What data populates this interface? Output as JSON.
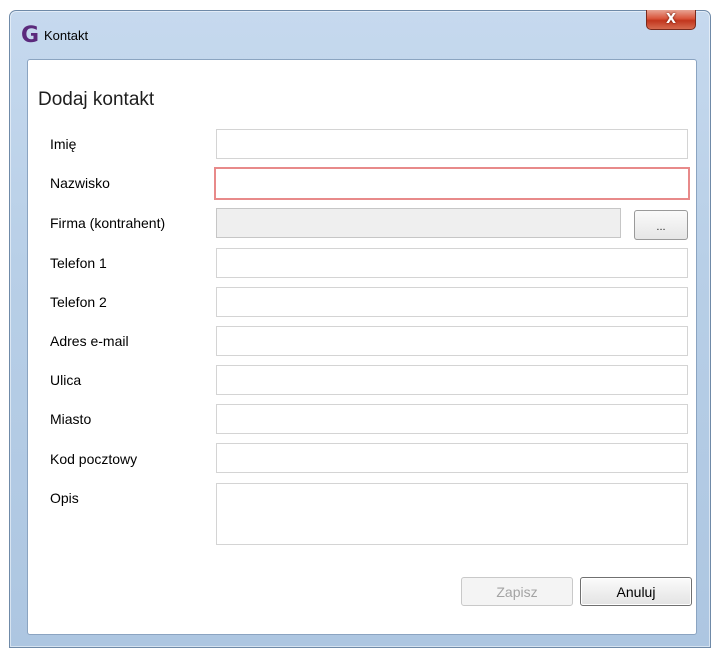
{
  "window": {
    "title": "Kontakt",
    "app_icon": "G",
    "close_label": "X"
  },
  "form": {
    "heading": "Dodaj kontakt",
    "fields": [
      {
        "label": "Imię",
        "value": ""
      },
      {
        "label": "Nazwisko",
        "value": ""
      },
      {
        "label": "Firma (kontrahent)",
        "value": ""
      },
      {
        "label": "Telefon 1",
        "value": ""
      },
      {
        "label": "Telefon 2",
        "value": ""
      },
      {
        "label": "Adres e-mail",
        "value": ""
      },
      {
        "label": "Ulica",
        "value": ""
      },
      {
        "label": "Miasto",
        "value": ""
      },
      {
        "label": "Kod pocztowy",
        "value": ""
      },
      {
        "label": "Opis",
        "value": ""
      }
    ],
    "browse_label": "...",
    "save_label": "Zapisz",
    "cancel_label": "Anuluj"
  },
  "colors": {
    "invalid_border": "#e88a8a",
    "app_icon": "#5b2a7c",
    "close_button": "#c2361d"
  },
  "icons": {
    "app": "g-logo-icon",
    "close": "close-icon"
  }
}
